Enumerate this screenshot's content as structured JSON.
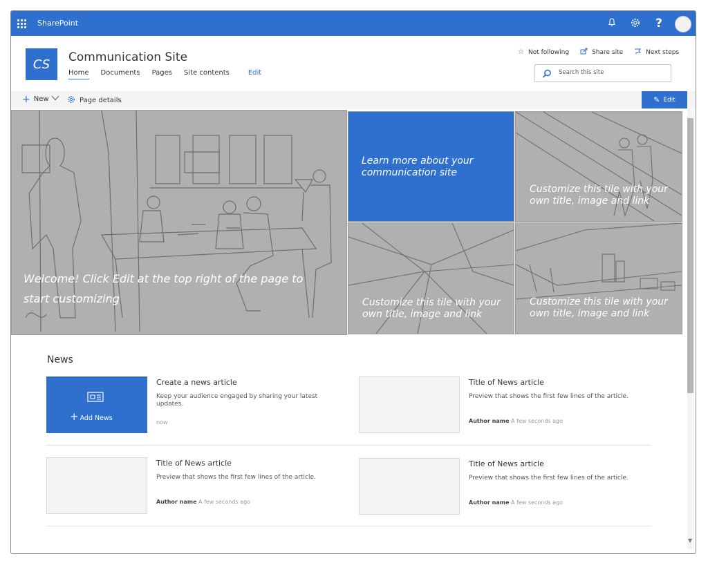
{
  "suite": {
    "title": "SharePoint",
    "icons": [
      "waffle-icon",
      "bell-icon",
      "gear-icon",
      "help-icon"
    ],
    "help_glyph": "?"
  },
  "site": {
    "logo_initials": "CS",
    "title": "Communication Site",
    "nav": [
      "Home",
      "Documents",
      "Pages",
      "Site contents"
    ],
    "nav_edit": "Edit",
    "actions": {
      "not_following": "Not following",
      "share_site": "Share site",
      "next_steps": "Next steps"
    },
    "search_placeholder": "Search this site"
  },
  "command_bar": {
    "new_label": "New",
    "page_details_label": "Page details",
    "edit_label": "Edit"
  },
  "hero": {
    "main_text": "Welcome! Click Edit at the top right of the page to start customizing",
    "tile_learn": "Learn more about your communication site",
    "tile_customize_1": "Customize this tile with your own title, image and link",
    "tile_customize_2": "Customize this tile with your own title, image and link",
    "tile_customize_3": "Customize this tile with your own title, image and link"
  },
  "news": {
    "title": "News",
    "add_news": "Add News",
    "items": [
      {
        "title": "Create a news article",
        "preview": "Keep your audience engaged by sharing your latest updates.",
        "author": "",
        "time": "now"
      },
      {
        "title": "Title of News article",
        "preview": "Preview that shows the first few lines of the article.",
        "author": "Author name",
        "time": "A few seconds ago"
      },
      {
        "title": "Title of News article",
        "preview": "Preview that shows the first few lines of the article.",
        "author": "Author name",
        "time": "A few seconds ago"
      },
      {
        "title": "Title of News article",
        "preview": "Preview that shows the first few lines of the article.",
        "author": "Author name",
        "time": "A few seconds ago"
      }
    ]
  },
  "colors": {
    "accent": "#2f6fcd",
    "placeholder_tile": "#b0b0b0",
    "command_bar": "#f4f4f4"
  }
}
